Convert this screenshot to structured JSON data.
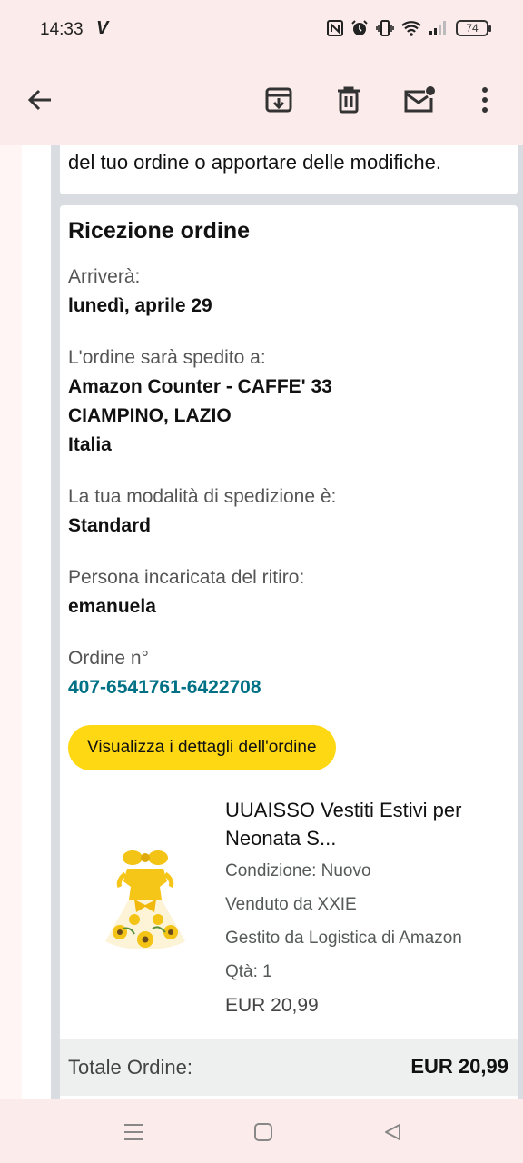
{
  "status_bar": {
    "time": "14:33",
    "carrier_glyph": "V",
    "battery": "74",
    "icons": [
      "nfc-icon",
      "alarm-icon",
      "vibrate-icon",
      "wifi-icon",
      "signal-icon"
    ]
  },
  "app_bar": {
    "icons": [
      "back-arrow-icon",
      "archive-icon",
      "delete-icon",
      "mark-unread-icon",
      "more-vert-icon"
    ]
  },
  "email": {
    "intro_tail": "del tuo ordine o apportare delle modifiche.",
    "section_title": "Ricezione ordine",
    "arrival_label": "Arriverà:",
    "arrival_value": "lunedì, aprile 29",
    "ship_label": "L'ordine sarà spedito a:",
    "ship_line1": "Amazon Counter - CAFFE' 33",
    "ship_line2": "CIAMPINO, LAZIO",
    "ship_line3": "Italia",
    "method_label": "La tua modalità di spedizione è:",
    "method_value": "Standard",
    "pickup_label": "Persona incaricata del ritiro:",
    "pickup_value": "emanuela",
    "order_label": "Ordine n°",
    "order_number": "407-6541761-6422708",
    "cta_label": "Visualizza i dettagli dell'ordine",
    "product": {
      "title_line1": "UUAISSO Vestiti Estivi per",
      "title_line2": "Neonata S...",
      "condition": "Condizione: Nuovo",
      "sold_by": "Venduto da XXIE",
      "fulfilled": "Gestito da Logistica di Amazon",
      "qty": "Qtà: 1",
      "price": "EUR 20,99"
    },
    "total_label": "Totale Ordine:",
    "total_value": "EUR 20,99"
  },
  "nav_bar": {
    "icons": [
      "recents-menu-icon",
      "home-square-icon",
      "back-triangle-icon"
    ]
  },
  "colors": {
    "top_bg": "#fbeceb",
    "link": "#007185",
    "cta": "#ffd814"
  }
}
